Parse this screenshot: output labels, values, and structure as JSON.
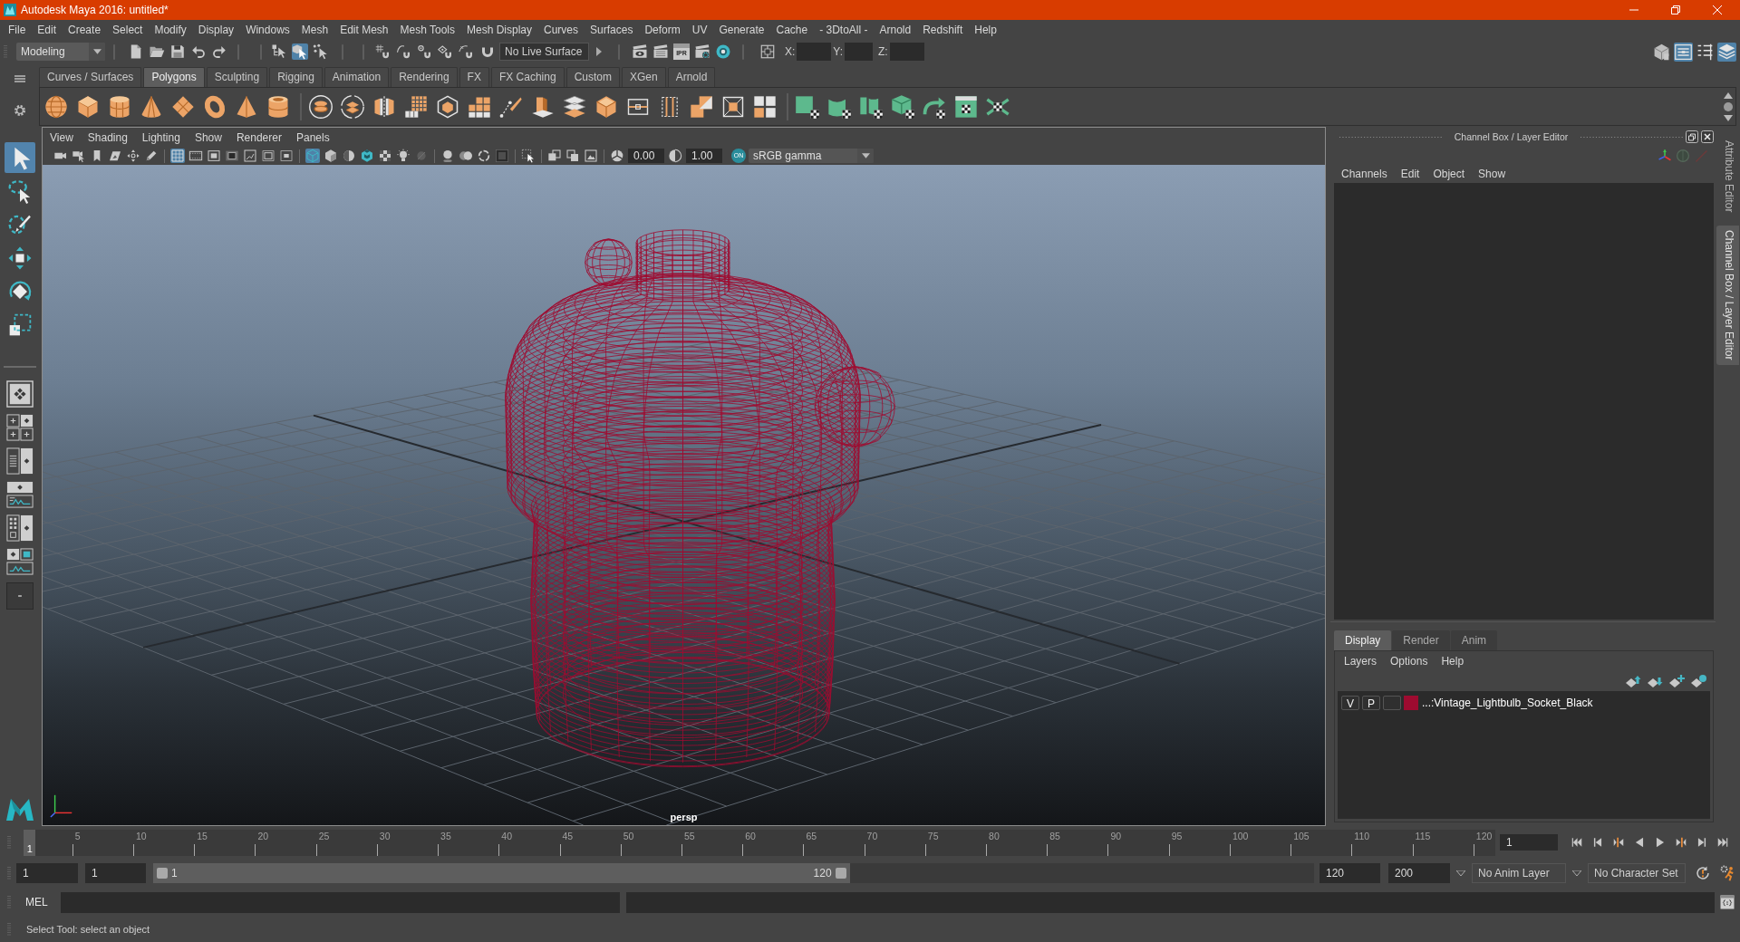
{
  "window": {
    "title": "Autodesk Maya 2016: untitled*"
  },
  "menu_bar": [
    "File",
    "Edit",
    "Create",
    "Select",
    "Modify",
    "Display",
    "Windows",
    "Mesh",
    "Edit Mesh",
    "Mesh Tools",
    "Mesh Display",
    "Curves",
    "Surfaces",
    "Deform",
    "UV",
    "Generate",
    "Cache",
    "- 3DtoAll -",
    "Arnold",
    "Redshift",
    "Help"
  ],
  "status_line": {
    "menu_set": "Modeling",
    "selection_modes": [
      {
        "selected": false
      },
      {
        "selected": true
      },
      {
        "selected": false
      }
    ],
    "live_surface": "No Live Surface",
    "ipr_label": "IPR",
    "coordinate_labels": [
      "X:",
      "Y:",
      "Z:"
    ],
    "panel_toggles": [
      {
        "on": false
      },
      {
        "on": true
      },
      {
        "on": false
      },
      {
        "on": true
      }
    ]
  },
  "shelf": {
    "tabs": [
      {
        "label": "Curves / Surfaces",
        "selected": false
      },
      {
        "label": "Polygons",
        "selected": true
      },
      {
        "label": "Sculpting",
        "selected": false
      },
      {
        "label": "Rigging",
        "selected": false
      },
      {
        "label": "Animation",
        "selected": false
      },
      {
        "label": "Rendering",
        "selected": false
      },
      {
        "label": "FX",
        "selected": false
      },
      {
        "label": "FX Caching",
        "selected": false
      },
      {
        "label": "Custom",
        "selected": false
      },
      {
        "label": "XGen",
        "selected": false
      },
      {
        "label": "Arnold",
        "selected": false
      }
    ]
  },
  "toolbox": {
    "tools": [
      {
        "selected": true
      },
      {
        "selected": false
      },
      {
        "selected": false
      },
      {
        "selected": false
      },
      {
        "selected": false
      },
      {
        "selected": false
      }
    ]
  },
  "viewport": {
    "menu": [
      "View",
      "Shading",
      "Lighting",
      "Show",
      "Renderer",
      "Panels"
    ],
    "toolbar": {
      "view_toggles": [
        {
          "on": true
        },
        {
          "on": false
        },
        {
          "on": false
        },
        {
          "on": false
        },
        {
          "on": false
        },
        {
          "on": false
        },
        {
          "on": false
        }
      ],
      "shading_toggles": [
        {
          "on": true
        },
        {
          "on": false
        },
        {
          "on": false
        },
        {
          "on": false
        },
        {
          "on": false
        },
        {
          "on": false
        },
        {
          "on": false
        }
      ],
      "exposure": "0.00",
      "gamma": "1.00",
      "color_management": "ON",
      "view_transform": "sRGB gamma"
    },
    "camera": "persp"
  },
  "channel_box": {
    "title": "Channel Box / Layer Editor",
    "menu": [
      "Channels",
      "Edit",
      "Object",
      "Show"
    ]
  },
  "layer_editor": {
    "tabs": [
      {
        "label": "Display",
        "selected": true
      },
      {
        "label": "Render",
        "selected": false
      },
      {
        "label": "Anim",
        "selected": false
      }
    ],
    "menu": [
      "Layers",
      "Options",
      "Help"
    ],
    "layers": [
      {
        "visibility": "V",
        "playback": "P",
        "color": "#9e0b30",
        "name": "...:Vintage_Lightbulb_Socket_Black"
      }
    ]
  },
  "side_tabs": [
    {
      "label": "Attribute Editor",
      "selected": false
    },
    {
      "label": "Channel Box / Layer Editor",
      "selected": true
    }
  ],
  "time_slider": {
    "ticks": [
      "5",
      "10",
      "15",
      "20",
      "25",
      "30",
      "35",
      "40",
      "45",
      "50",
      "55",
      "60",
      "65",
      "70",
      "75",
      "80",
      "85",
      "90",
      "95",
      "100",
      "105",
      "110",
      "115",
      "120"
    ],
    "playhead": {
      "label": "1",
      "level": 0
    },
    "current_frame": "1"
  },
  "range_slider": {
    "start_time": "1",
    "playback_start": "1",
    "range_start": "1",
    "range_end": "120",
    "level": 0.6,
    "playback_end": "120",
    "end_time": "200",
    "anim_layer": "No Anim Layer",
    "character_set": "No Character Set"
  },
  "command_line": {
    "language": "MEL"
  },
  "help_line": {
    "text": "Select Tool: select an object"
  }
}
